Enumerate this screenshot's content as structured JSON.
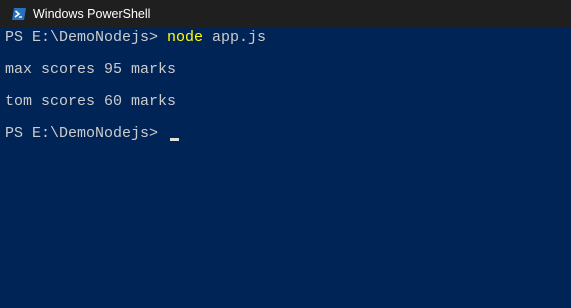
{
  "window": {
    "title": "Windows PowerShell",
    "icon": "powershell-icon"
  },
  "console": {
    "background": "#012456",
    "text_color": "#cccccc",
    "command_color": "#ffff00",
    "lines": [
      {
        "prompt": "PS E:\\DemoNodejs> ",
        "command": "node",
        "args": " app.js"
      },
      {
        "output": "max scores 95 marks"
      },
      {
        "output": "tom scores 60 marks"
      },
      {
        "prompt": "PS E:\\DemoNodejs> "
      }
    ]
  }
}
